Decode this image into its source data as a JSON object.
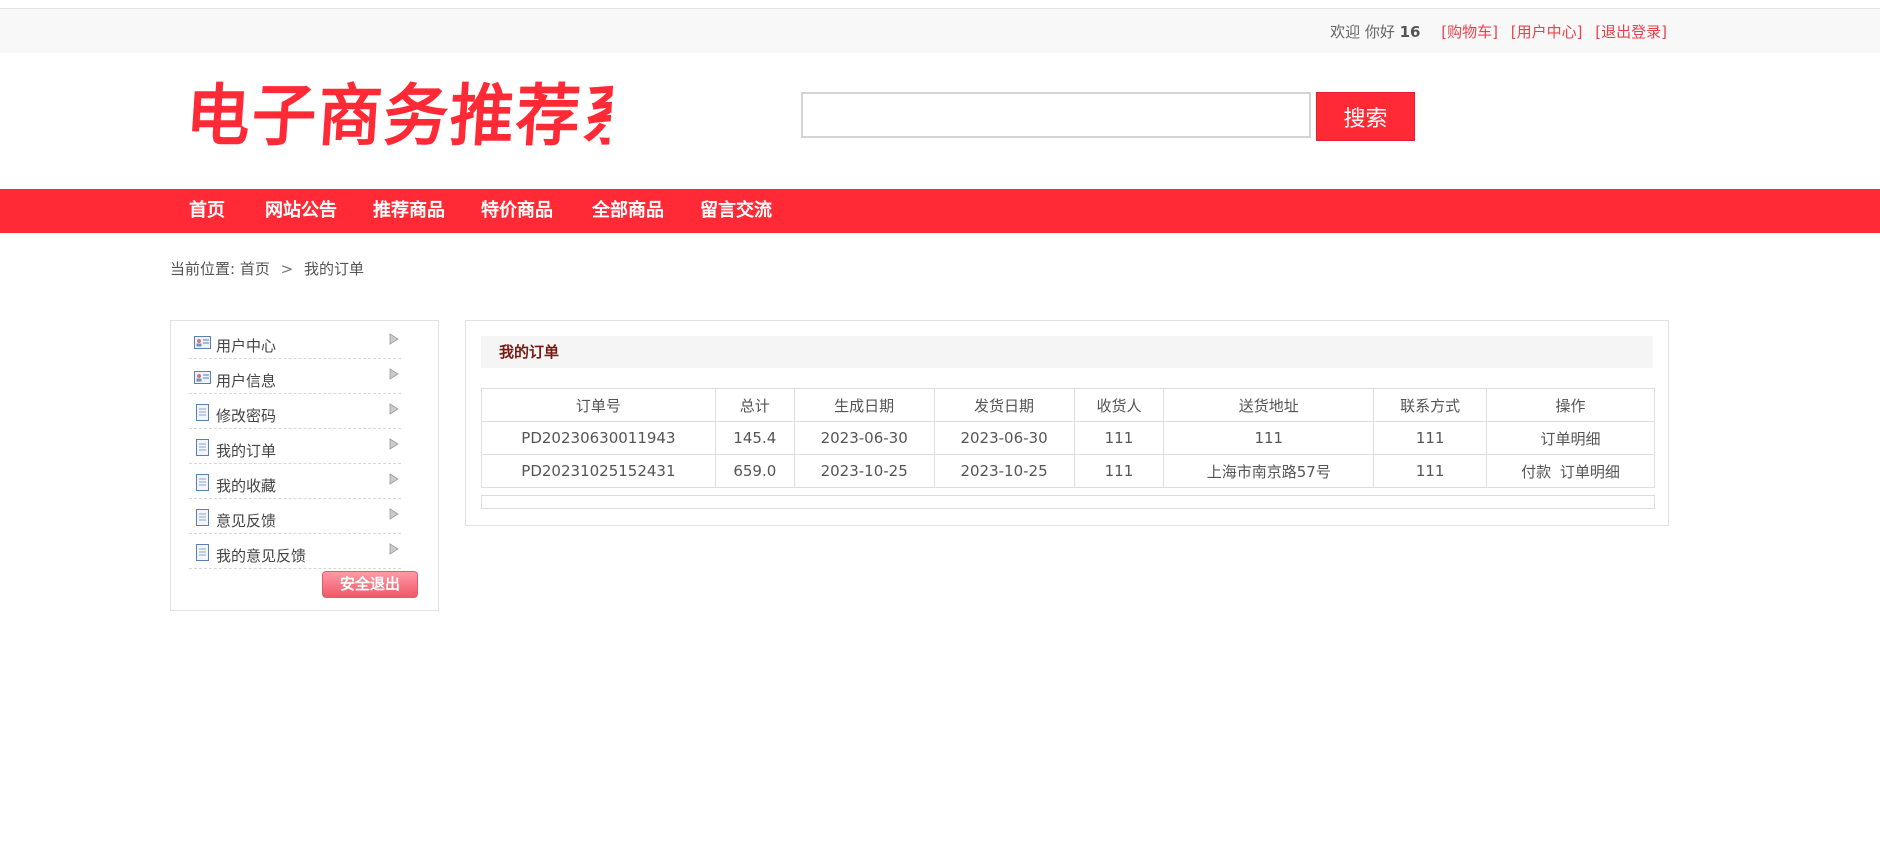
{
  "topbar": {
    "welcome": "欢迎 你好",
    "username": "16",
    "links": [
      "[购物车]",
      "[用户中心]",
      "[退出登录]"
    ]
  },
  "header": {
    "logo_text": "电子商务推荐系统",
    "search_value": "",
    "search_button": "搜索"
  },
  "nav": {
    "items": [
      "首页",
      "网站公告",
      "推荐商品",
      "特价商品",
      "全部商品",
      "留言交流"
    ]
  },
  "breadcrumb": {
    "prefix": "当前位置:",
    "home": "首页",
    "separator": ">",
    "current": "我的订单"
  },
  "sidebar": {
    "items": [
      {
        "label": "用户中心",
        "icon": "id-card-icon"
      },
      {
        "label": "用户信息",
        "icon": "id-card-icon"
      },
      {
        "label": "修改密码",
        "icon": "document-icon"
      },
      {
        "label": "我的订单",
        "icon": "document-icon"
      },
      {
        "label": "我的收藏",
        "icon": "document-icon"
      },
      {
        "label": "意见反馈",
        "icon": "document-icon"
      },
      {
        "label": "我的意见反馈",
        "icon": "document-icon"
      }
    ],
    "logout_button": "安全退出"
  },
  "orders": {
    "title": "我的订单",
    "columns": [
      "订单号",
      "总计",
      "生成日期",
      "发货日期",
      "收货人",
      "送货地址",
      "联系方式",
      "操作"
    ],
    "rows": [
      {
        "id": "PD20230630011943",
        "total": "145.4",
        "created": "2023-06-30",
        "shipped": "2023-06-30",
        "receiver": "111",
        "address": "111",
        "contact": "111",
        "actions": [
          "订单明细"
        ]
      },
      {
        "id": "PD20231025152431",
        "total": "659.0",
        "created": "2023-10-25",
        "shipped": "2023-10-25",
        "receiver": "111",
        "address": "上海市南京路57号",
        "contact": "111",
        "actions": [
          "付款",
          "订单明细"
        ]
      }
    ]
  },
  "colors": {
    "brand_red": "#ff2a35",
    "link_red": "#e8434d",
    "title_dark_red": "#7a1a14"
  }
}
